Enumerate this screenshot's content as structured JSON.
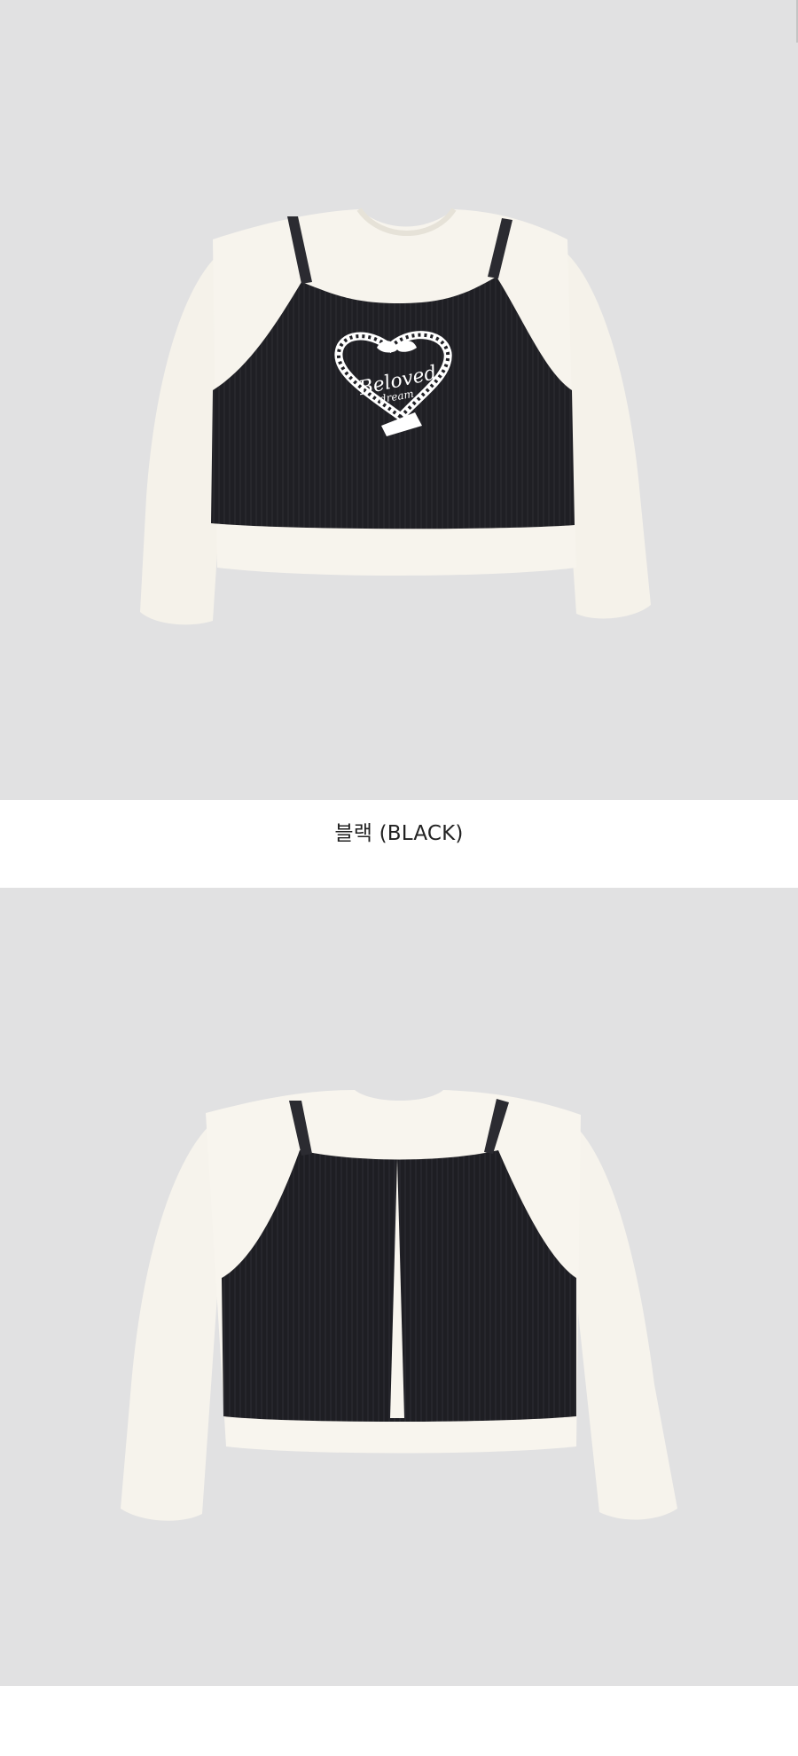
{
  "page": {
    "caption": "블랙 (BLACK)",
    "front_emblem": {
      "script_text": "Beloved",
      "sub_text": "dream"
    }
  },
  "colors": {
    "backdrop": "#e1e1e2",
    "tee": "#f6f3ec",
    "vest": "#1f1f24",
    "emblem": "#ffffff"
  },
  "icons": {
    "front_graphic": "heart-ribbon-emblem-icon"
  }
}
